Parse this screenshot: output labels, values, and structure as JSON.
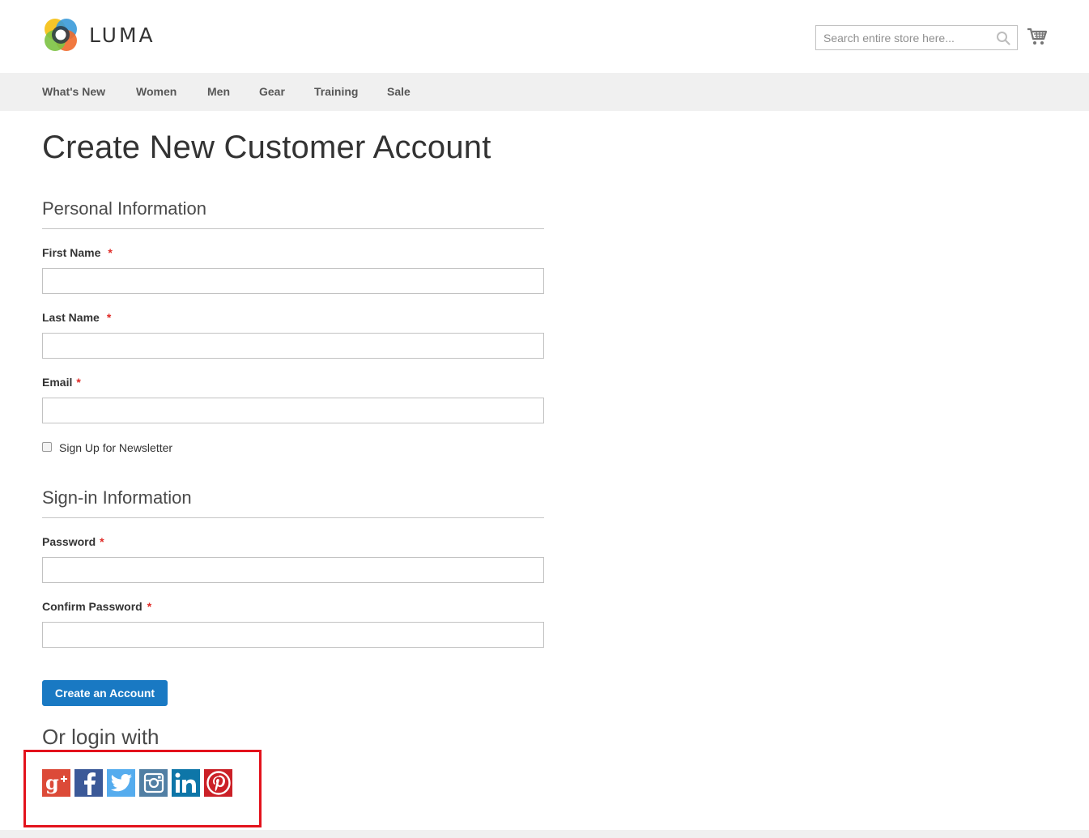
{
  "header": {
    "logo_text": "LUMA",
    "search_placeholder": "Search entire store here..."
  },
  "nav": {
    "items": [
      {
        "label": "What's New"
      },
      {
        "label": "Women"
      },
      {
        "label": "Men"
      },
      {
        "label": "Gear"
      },
      {
        "label": "Training"
      },
      {
        "label": "Sale"
      }
    ]
  },
  "page": {
    "title": "Create New Customer Account"
  },
  "personal": {
    "section_title": "Personal Information",
    "first_name_label": "First Name",
    "last_name_label": "Last Name",
    "email_label": "Email",
    "required_mark": "*",
    "newsletter_label": "Sign Up for Newsletter",
    "newsletter_checked": false,
    "first_name_value": "",
    "last_name_value": "",
    "email_value": ""
  },
  "signin": {
    "section_title": "Sign-in Information",
    "password_label": "Password",
    "confirm_password_label": "Confirm Password",
    "password_value": "",
    "confirm_password_value": ""
  },
  "actions": {
    "create_account_label": "Create an Account"
  },
  "social": {
    "heading": "Or login with",
    "providers": [
      {
        "name": "google-plus-icon",
        "color": "#dc4a38"
      },
      {
        "name": "facebook-icon",
        "color": "#3b5998"
      },
      {
        "name": "twitter-icon",
        "color": "#55acee"
      },
      {
        "name": "instagram-icon",
        "color": "#517fa4"
      },
      {
        "name": "linkedin-icon",
        "color": "#0e76a8"
      },
      {
        "name": "pinterest-icon",
        "color": "#cb2027"
      }
    ],
    "highlight_color": "#e3121c"
  },
  "colors": {
    "primary_button": "#1979c3",
    "nav_background": "#f0f0f0",
    "required": "#e02b27"
  }
}
